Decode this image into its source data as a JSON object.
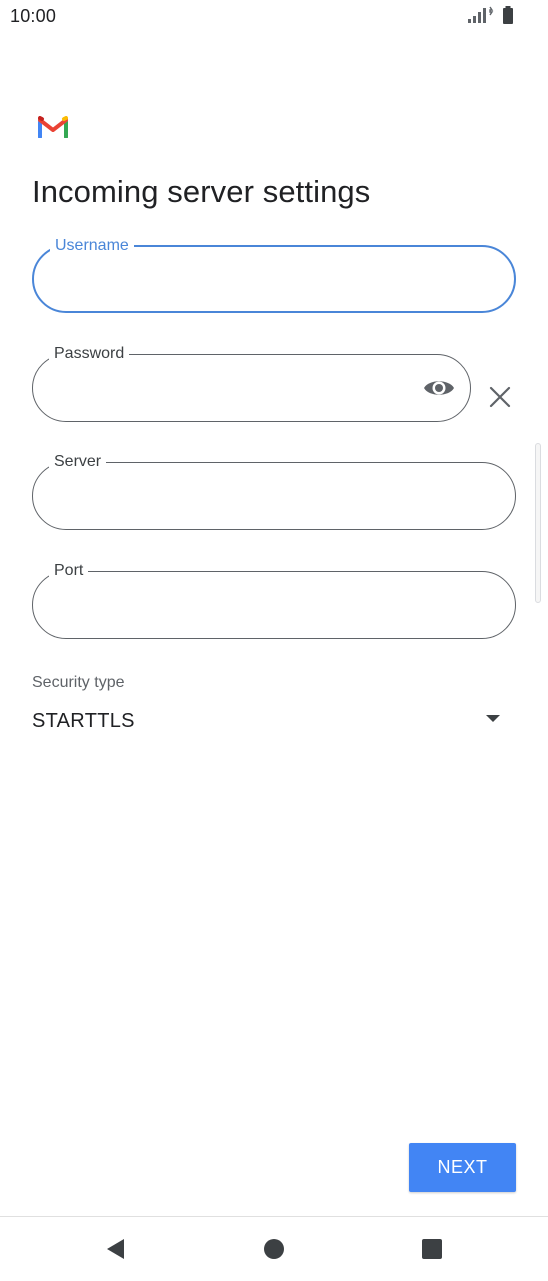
{
  "status_bar": {
    "time": "10:00",
    "signal_icon": "signal-icon",
    "battery_icon": "battery-icon"
  },
  "app": {
    "logo_icon": "gmail-logo-icon",
    "brand_colors": {
      "red": "#ea4335",
      "blue": "#4285f4",
      "green": "#34a853",
      "yellow": "#fbbc04"
    }
  },
  "page": {
    "title": "Incoming server settings"
  },
  "form": {
    "username": {
      "label": "Username",
      "value": "",
      "focused": true
    },
    "password": {
      "label": "Password",
      "value": "",
      "show_icon": "eye-icon",
      "clear_icon": "close-icon"
    },
    "server": {
      "label": "Server",
      "value": ""
    },
    "port": {
      "label": "Port",
      "value": ""
    },
    "security_type": {
      "label": "Security type",
      "value": "STARTTLS",
      "dropdown_icon": "arrow-drop-down-icon"
    }
  },
  "actions": {
    "next_label": "NEXT"
  },
  "accent_color": "#4a86d8",
  "nav_bar": {
    "back_icon": "back-icon",
    "home_icon": "home-icon",
    "recents_icon": "recents-icon"
  }
}
